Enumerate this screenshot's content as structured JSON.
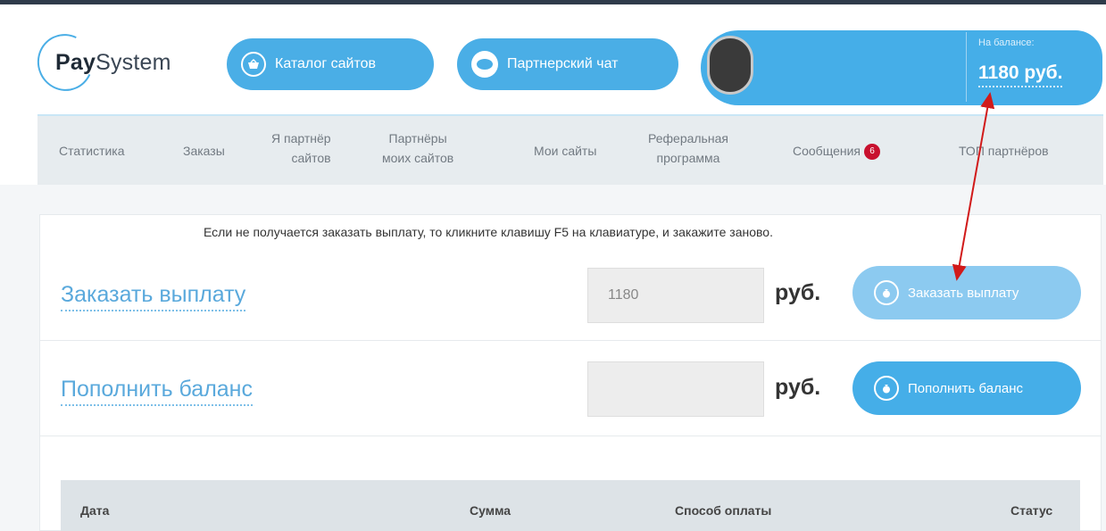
{
  "header": {
    "logo_bold": "Pay",
    "logo_rest": "System",
    "catalog_label": "Каталог сайтов",
    "chat_label": "Партнерский чат",
    "balance_label": "На балансе:",
    "balance_value": "1180 руб."
  },
  "nav": {
    "items": [
      {
        "line1": "Статистика",
        "line2": ""
      },
      {
        "line1": "Заказы",
        "line2": ""
      },
      {
        "line1": "Я партнёр",
        "line2": "сайтов"
      },
      {
        "line1": "Партнёры",
        "line2": "моих сайтов"
      },
      {
        "line1": "Мои сайты",
        "line2": ""
      },
      {
        "line1": "Реферальная",
        "line2": "программа"
      },
      {
        "line1": "Сообщения",
        "line2": ""
      },
      {
        "line1": "ТОП партнёров",
        "line2": ""
      }
    ],
    "messages_badge": "6"
  },
  "notice": "Если не получается заказать выплату, то кликните клавишу F5 на клавиатуре, и закажите заново.",
  "payout": {
    "title": "Заказать выплату",
    "amount": "1180",
    "currency": "руб.",
    "button": "Заказать выплату"
  },
  "topup": {
    "title": "Пополнить баланс",
    "amount": "",
    "currency": "руб.",
    "button": "Пополнить баланс"
  },
  "table": {
    "columns": [
      "Дата",
      "Сумма",
      "Способ оплаты",
      "Статус"
    ]
  },
  "colors": {
    "accent": "#45aee8",
    "nav_bg": "#e7ecef",
    "badge": "#c8102e",
    "annotation": "#d11a1a"
  },
  "icons": {
    "catalog": "basket-icon",
    "chat": "chat-bubble-icon",
    "payout": "money-bag-icon",
    "topup": "money-bag-icon"
  }
}
